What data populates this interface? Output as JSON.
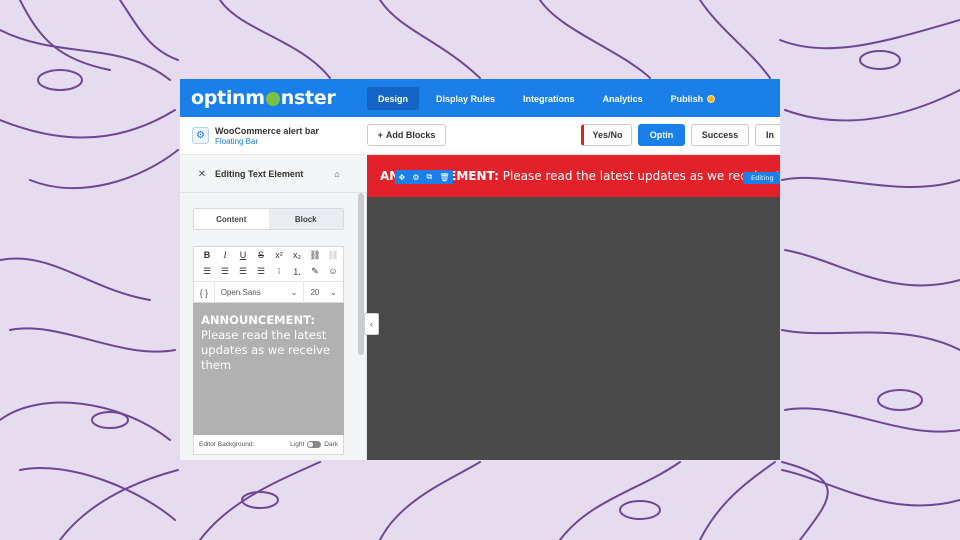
{
  "colors": {
    "nav_blue": "#1a7fe8",
    "alert_red": "#e3212a",
    "canvas_gray": "#4a4a4a",
    "editor_gray": "#b1b1b1",
    "background_lilac": "#e6dcef",
    "floral_line": "#5b2d86"
  },
  "brand": {
    "logo_text_left": "optinm",
    "logo_text_right": "nster"
  },
  "nav": {
    "tabs": [
      {
        "label": "Design",
        "active": true
      },
      {
        "label": "Display Rules",
        "active": false
      },
      {
        "label": "Integrations",
        "active": false
      },
      {
        "label": "Analytics",
        "active": false
      },
      {
        "label": "Publish",
        "active": false
      }
    ]
  },
  "subheader": {
    "campaign_name": "WooCommerce alert bar",
    "campaign_type": "Floating Bar",
    "add_blocks_label": "Add Blocks",
    "views": [
      {
        "label": "Yes/No",
        "active": false
      },
      {
        "label": "Optin",
        "active": true
      },
      {
        "label": "Success",
        "active": false
      },
      {
        "label": "In",
        "active": false
      }
    ]
  },
  "panel": {
    "title": "Editing Text Element",
    "segments": {
      "content": "Content",
      "block": "Block"
    },
    "toolbar": {
      "font_brace": "{ }",
      "font_family": "Open Sans",
      "font_size": "20"
    },
    "editor": {
      "bold_text": "ANNOUNCEMENT:",
      "body_text": "Please read the latest updates as we receive them"
    },
    "footer": {
      "label": "Editor Background:",
      "light": "Light",
      "dark": "Dark"
    }
  },
  "canvas": {
    "alert_bold": "ANNOUNCEMENT:",
    "alert_text": "Please read the latest updates as we receive them",
    "editing_badge": "Editing"
  }
}
